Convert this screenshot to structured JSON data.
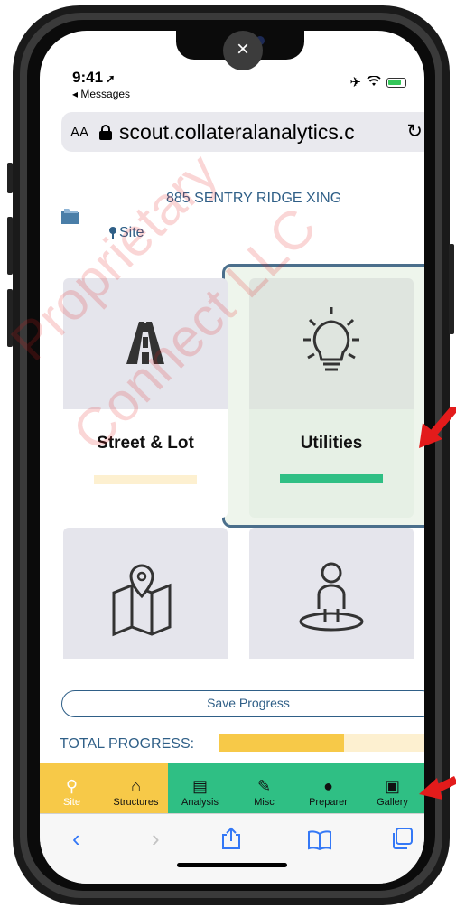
{
  "safari": {
    "status_time": "9:41",
    "back_label": "◂ Messages",
    "text_size_label": "AA",
    "url": "scout.collateralanalytics.c",
    "close_glyph": "×"
  },
  "header": {
    "address": "885 SENTRY RIDGE XING",
    "section_label": "Site"
  },
  "tiles": [
    {
      "label": "Street & Lot",
      "icon": "road-icon",
      "bar_color": "#fdf0d0",
      "bar_fraction": 0.0
    },
    {
      "label": "Utilities",
      "icon": "lightbulb-icon",
      "bar_color": "#2fbf84",
      "bar_fraction": 1.0,
      "selected": true
    },
    {
      "label": "",
      "icon": "map-pin-icon"
    },
    {
      "label": "",
      "icon": "person-pin-icon"
    }
  ],
  "save_button_label": "Save Progress",
  "total_progress": {
    "label": "TOTAL PROGRESS:",
    "fraction": 0.58,
    "fill_color": "#f7c948",
    "track_color": "#fdf0d0"
  },
  "tabbar": {
    "items": [
      {
        "label": "Site",
        "icon": "pin-icon",
        "bg": "#f7c948",
        "color": "#ffffff"
      },
      {
        "label": "Structures",
        "icon": "house-icon",
        "bg": "#f7c948",
        "color": "#111111"
      },
      {
        "label": "Analysis",
        "icon": "document-icon",
        "bg": "#2fbf84",
        "color": "#111111"
      },
      {
        "label": "Misc",
        "icon": "edit-icon",
        "bg": "#2fbf84",
        "color": "#111111"
      },
      {
        "label": "Preparer",
        "icon": "user-icon",
        "bg": "#2fbf84",
        "color": "#111111"
      },
      {
        "label": "Gallery",
        "icon": "image-icon",
        "bg": "#2fbf84",
        "color": "#111111"
      }
    ]
  },
  "colors": {
    "accent_blue": "#2f5f87",
    "green": "#2fbf84",
    "yellow": "#f7c948",
    "annotation_red": "#e31b1b"
  }
}
